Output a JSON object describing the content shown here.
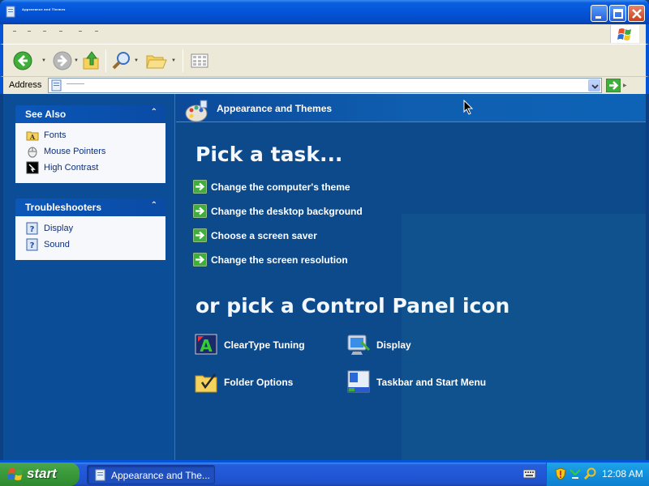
{
  "window": {
    "title": "Appearance and Themes",
    "controls": {
      "minimize": "minimize",
      "maximize": "maximize",
      "close": "close"
    }
  },
  "toolbar": {
    "back_icon": "back-arrow-icon",
    "forward_icon": "forward-arrow-icon",
    "up_icon": "up-folder-icon",
    "search_icon": "search-icon",
    "folders_icon": "folders-icon",
    "views_icon": "views-icon"
  },
  "address": {
    "label": "Address",
    "value": ""
  },
  "sidebar": {
    "see_also": {
      "title": "See Also",
      "items": [
        {
          "label": "Fonts",
          "icon": "fonts-folder-icon"
        },
        {
          "label": "Mouse Pointers",
          "icon": "mouse-icon"
        },
        {
          "label": "High Contrast",
          "icon": "high-contrast-icon"
        }
      ]
    },
    "troubleshooters": {
      "title": "Troubleshooters",
      "items": [
        {
          "label": "Display",
          "icon": "help-icon"
        },
        {
          "label": "Sound",
          "icon": "help-icon"
        }
      ]
    }
  },
  "content": {
    "header_title": "Appearance and Themes",
    "pick_task_heading": "Pick a task...",
    "tasks": [
      "Change the computer's theme",
      "Change the desktop background",
      "Choose a screen saver",
      "Change the screen resolution"
    ],
    "pick_icon_heading": "or pick a Control Panel icon",
    "icons": [
      {
        "label": "ClearType Tuning",
        "icon": "cleartype-icon"
      },
      {
        "label": "Display",
        "icon": "display-icon"
      },
      {
        "label": "Folder Options",
        "icon": "folder-options-icon"
      },
      {
        "label": "Taskbar and Start Menu",
        "icon": "taskbar-icon"
      }
    ]
  },
  "taskbar": {
    "start_label": "start",
    "task_button_label": "Appearance and The...",
    "clock": "12:08 AM"
  },
  "colors": {
    "content_bg": "#0d4a8c",
    "title_bar": "#0454d8",
    "start_green": "#3c9b3c"
  }
}
